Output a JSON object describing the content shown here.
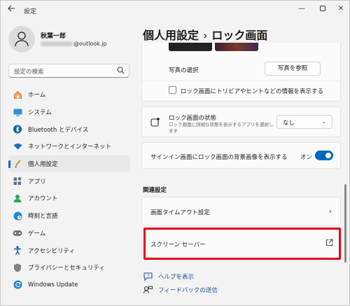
{
  "window": {
    "title": "設定",
    "back_icon": "arrow-left-icon"
  },
  "user": {
    "name": "秋葉一郎",
    "email_suffix": "@outlook.jp"
  },
  "search": {
    "placeholder": "設定の検索"
  },
  "nav": {
    "items": [
      {
        "label": "ホーム",
        "icon": "home-icon"
      },
      {
        "label": "システム",
        "icon": "system-icon"
      },
      {
        "label": "Bluetooth とデバイス",
        "icon": "bluetooth-icon"
      },
      {
        "label": "ネットワークとインターネット",
        "icon": "wifi-icon"
      },
      {
        "label": "個人用設定",
        "icon": "brush-icon",
        "active": true
      },
      {
        "label": "アプリ",
        "icon": "apps-icon"
      },
      {
        "label": "アカウント",
        "icon": "account-icon"
      },
      {
        "label": "時刻と言語",
        "icon": "globe-clock-icon"
      },
      {
        "label": "ゲーム",
        "icon": "gamepad-icon"
      },
      {
        "label": "アクセシビリティ",
        "icon": "accessibility-icon"
      },
      {
        "label": "プライバシーとセキュリティ",
        "icon": "shield-icon"
      },
      {
        "label": "Windows Update",
        "icon": "update-icon"
      }
    ]
  },
  "breadcrumb": {
    "parent": "個人用設定",
    "separator": "›",
    "current": "ロック画面"
  },
  "lock_screen": {
    "photo_select_label": "写真の選択",
    "browse_button": "写真を参照",
    "tips_checkbox_label": "ロック画面にトリビアやヒントなどの情報を表示する",
    "tips_checked": false
  },
  "status": {
    "title": "ロック画面の状態",
    "description": "ロック画面に詳細な状態を表示するアプリを選択します",
    "selected": "なし"
  },
  "signin_background": {
    "label": "サインイン画面にロック画面の背景画像を表示する",
    "state_label": "オン",
    "on": true
  },
  "related": {
    "heading": "関連設定",
    "screen_timeout": "画面タイムアウト設定",
    "screen_saver": "スクリーン セーバー"
  },
  "links": {
    "help": "ヘルプを表示",
    "feedback": "フィードバックの送信"
  },
  "colors": {
    "accent": "#0067c0",
    "highlight": "#e60012"
  }
}
